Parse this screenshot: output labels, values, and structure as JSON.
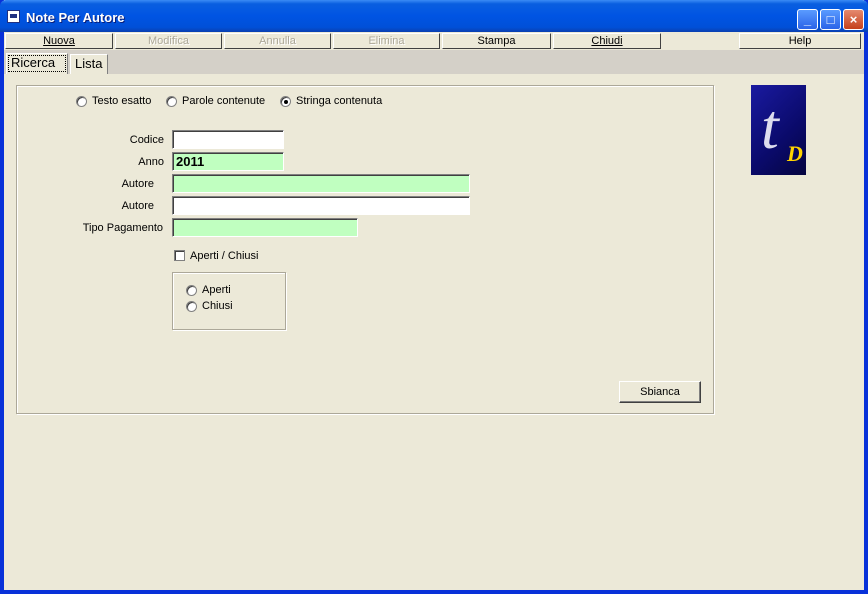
{
  "window": {
    "title": "Note Per Autore"
  },
  "title_buttons": {
    "minimize": "_",
    "maximize": "□",
    "close": "×"
  },
  "menu": {
    "nuova": "Nuova",
    "modifica": "Modifica",
    "annulla": "Annulla",
    "elimina": "Elimina",
    "stampa": "Stampa",
    "chiudi": "Chiudi",
    "help": "Help"
  },
  "tabs": [
    {
      "label": "Ricerca",
      "active": true
    },
    {
      "label": "Lista",
      "active": false
    }
  ],
  "search_mode": {
    "options": [
      "Testo esatto",
      "Parole contenute",
      "Stringa contenuta"
    ],
    "selected": "Stringa contenuta"
  },
  "form": {
    "codice_label": "Codice",
    "codice_value": "",
    "anno_label": "Anno",
    "anno_value": "2011",
    "autore1_label": "Autore",
    "autore1_value": "",
    "autore2_label": "Autore",
    "autore2_value": "",
    "tipo_pagamento_label": "Tipo Pagamento",
    "tipo_pagamento_value": ""
  },
  "aperti_chiusi": {
    "checkbox_label": "Aperti / Chiusi",
    "checked": false,
    "options": [
      "Aperti",
      "Chiusi"
    ]
  },
  "buttons": {
    "sbianca": "Sbianca"
  },
  "logo": {
    "letters": "t",
    "sub": "D"
  },
  "colors": {
    "title_bar": "#0054e3",
    "required_field": "#c0ffc0",
    "face": "#ece9d8"
  }
}
